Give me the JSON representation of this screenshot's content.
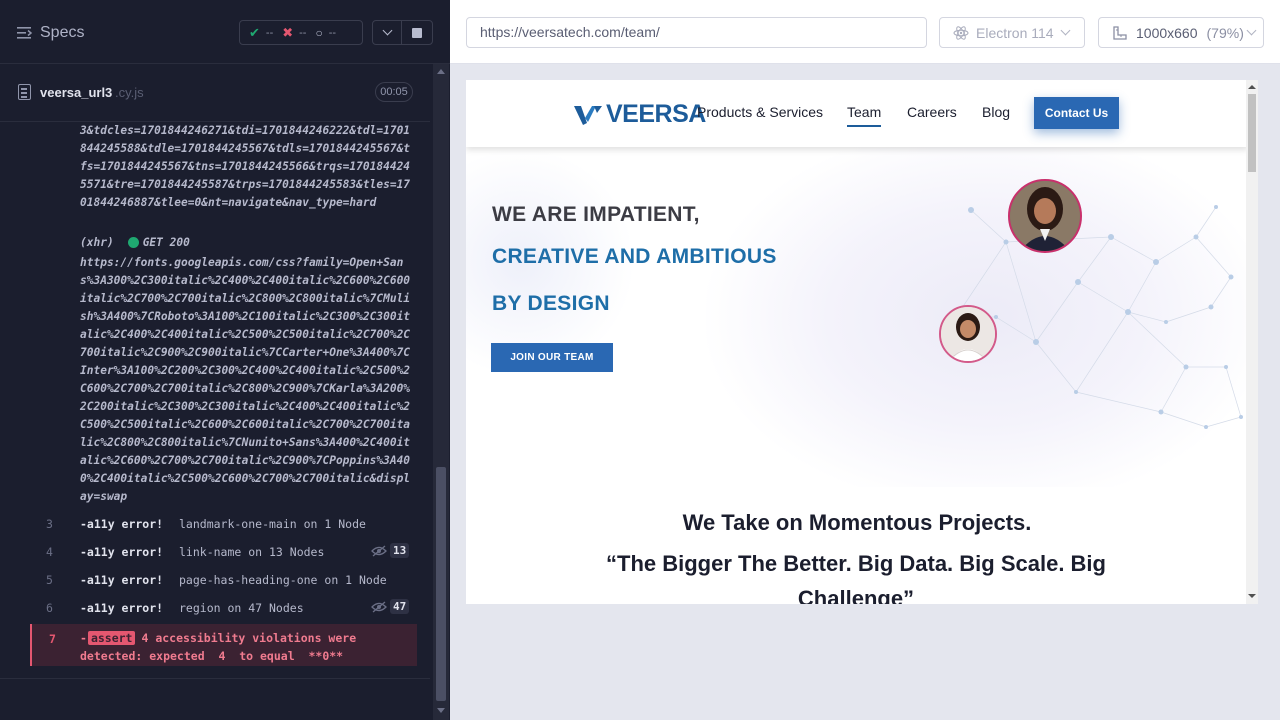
{
  "specs_panel": {
    "title": "Specs",
    "stats": {
      "passed": "--",
      "failed": "--",
      "pending": "--"
    },
    "file": {
      "name": "veersa_url3",
      "ext": ".cy.js",
      "duration": "00:05"
    },
    "log_url_tail": "3&tdcles=1701844246271&tdi=1701844246222&tdl=1701844245588&tdle=1701844245567&tdls=1701844245567&tfs=1701844245567&tns=1701844245566&trqs=1701844245571&tre=1701844245587&trps=1701844245583&tles=1701844246887&tlee=0&nt=navigate&nav_type=hard",
    "xhr": {
      "label": "(xhr)",
      "method": "GET 200",
      "url": "https://fonts.googleapis.com/css?family=Open+Sans%3A300%2C300italic%2C400%2C400italic%2C600%2C600italic%2C700%2C700italic%2C800%2C800italic%7CMulish%3A400%7CRoboto%3A100%2C100italic%2C300%2C300italic%2C400%2C400italic%2C500%2C500italic%2C700%2C700italic%2C900%2C900italic%7CCarter+One%3A400%7CInter%3A100%2C200%2C300%2C400%2C400italic%2C500%2C600%2C700%2C700italic%2C800%2C900%7CKarla%3A200%2C200italic%2C300%2C300italic%2C400%2C400italic%2C500%2C500italic%2C600%2C600italic%2C700%2C700italic%2C800%2C800italic%7CNunito+Sans%3A400%2C400italic%2C600%2C700%2C700italic%2C900%7CPoppins%3A400%2C400italic%2C500%2C600%2C700%2C700italic&display=swap"
    },
    "commands": [
      {
        "num": "3",
        "name": "-a11y error!",
        "msg": "landmark-one-main on 1 Node",
        "count": ""
      },
      {
        "num": "4",
        "name": "-a11y error!",
        "msg": "link-name on 13 Nodes",
        "count": "13"
      },
      {
        "num": "5",
        "name": "-a11y error!",
        "msg": "page-has-heading-one on 1 Node",
        "count": ""
      },
      {
        "num": "6",
        "name": "-a11y error!",
        "msg": "region on 47 Nodes",
        "count": "47"
      }
    ],
    "assert": {
      "num": "7",
      "tag": "assert",
      "line1": "4 accessibility violations were",
      "line2": "detected: expected  4  to equal  **0**"
    }
  },
  "aut_header": {
    "url": "https://veersatech.com/team/",
    "browser": "Electron 114",
    "viewport": "1000x660",
    "zoom": "(79%)"
  },
  "site": {
    "logo": "VEERSA",
    "nav": [
      "Products & Services",
      "Team",
      "Careers",
      "Blog"
    ],
    "contact": "Contact Us",
    "hero": {
      "line1": "WE ARE IMPATIENT,",
      "line2": "CREATIVE AND AMBITIOUS",
      "line3": "BY DESIGN",
      "cta": "JOIN OUR TEAM"
    },
    "section_title": "We Take on Momentous Projects.",
    "quote": "“The Bigger The Better. Big Data. Big Scale. Big Challenge”"
  },
  "colors": {
    "brand_blue": "#2a68b3",
    "heading_blue": "#1e6ea8",
    "pass_green": "#1fa971",
    "fail_red": "#e45770"
  }
}
